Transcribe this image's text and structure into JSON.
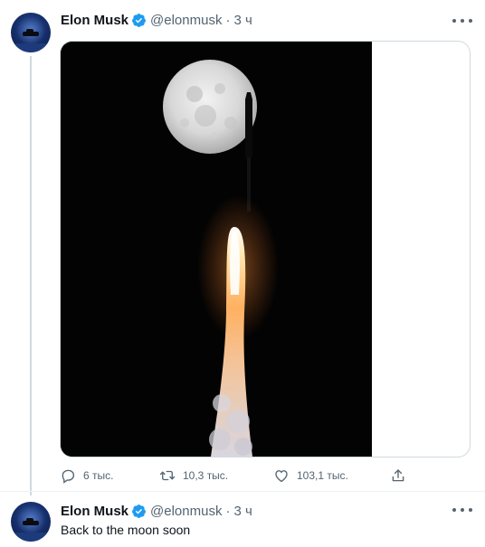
{
  "tweets": [
    {
      "author_name": "Elon Musk",
      "handle": "@elonmusk",
      "separator": "·",
      "time": "3 ч",
      "actions": {
        "reply_count": "6 тыс.",
        "retweet_count": "10,3 тыс.",
        "like_count": "103,1 тыс."
      }
    },
    {
      "author_name": "Elon Musk",
      "handle": "@elonmusk",
      "separator": "·",
      "time": "3 ч",
      "text": "Back to the moon soon"
    }
  ],
  "icons": {
    "verified": "verified-badge-icon",
    "more": "more-icon",
    "reply": "reply-icon",
    "retweet": "retweet-icon",
    "like": "heart-icon",
    "share": "share-icon"
  },
  "colors": {
    "verified_blue": "#1d9bf0",
    "text_primary": "#0f1419",
    "text_secondary": "#536471",
    "border": "#cfd9de"
  }
}
